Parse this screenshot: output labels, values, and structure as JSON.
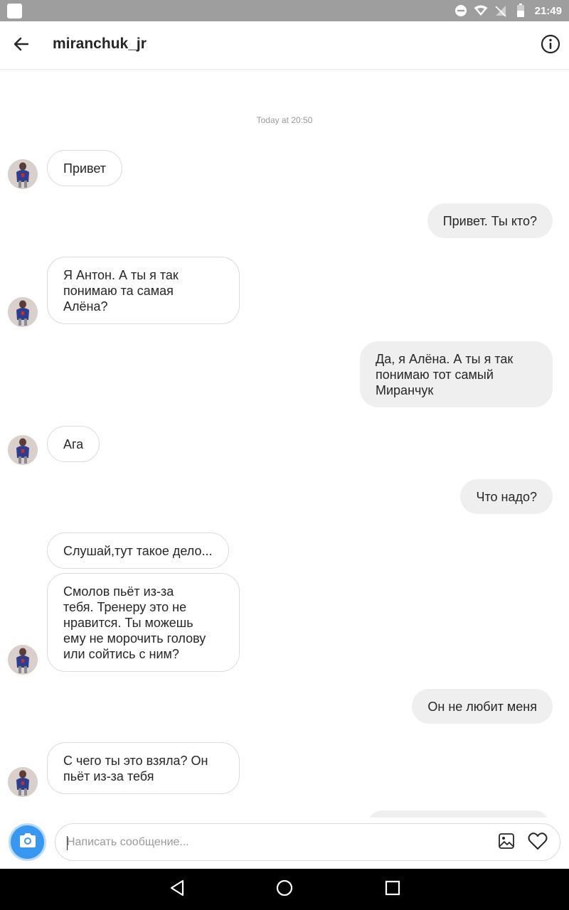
{
  "status_bar": {
    "time": "21:49",
    "icons": [
      "notification-icon",
      "dnd-icon",
      "wifi-icon",
      "no-signal-icon",
      "battery-icon"
    ]
  },
  "header": {
    "username": "miranchuk_jr",
    "icons": [
      "back-arrow-icon",
      "info-icon"
    ]
  },
  "chat": {
    "timestamp": "Today at 20:50",
    "messages": [
      {
        "side": "in",
        "text": "Привет"
      },
      {
        "side": "out",
        "text": "Привет. Ты кто?"
      },
      {
        "side": "in",
        "text": "Я Антон. А ты я так\nпонимаю та самая\nАлёна?"
      },
      {
        "side": "out",
        "text": "Да, я Алёна. А ты я так\nпонимаю тот самый\nМиранчук"
      },
      {
        "side": "in",
        "text": "Ага"
      },
      {
        "side": "out",
        "text": "Что надо?"
      },
      {
        "side": "in",
        "text": "Слушай,тут такое дело..."
      },
      {
        "side": "in",
        "text": "Смолов пьёт из-за\nтебя. Тренеру это не\nнравится. Ты можешь\nему не морочить голову\nили сойтись с ним?"
      },
      {
        "side": "out",
        "text": "Он не любит меня"
      },
      {
        "side": "in",
        "text": "С чего ты это взяла? Он\nпьёт из-за тебя"
      }
    ]
  },
  "composer": {
    "placeholder": "Написать сообщение...",
    "value": "",
    "icons": [
      "camera-icon",
      "gallery-icon",
      "heart-icon"
    ]
  },
  "nav_bar": {
    "icons": [
      "back-triangle-icon",
      "home-circle-icon",
      "recents-square-icon"
    ]
  },
  "colors": {
    "accent": "#3897f0",
    "bubble_out": "#efefef",
    "bubble_in_border": "#dbdbdb",
    "status_bar": "#9e9e9e"
  }
}
